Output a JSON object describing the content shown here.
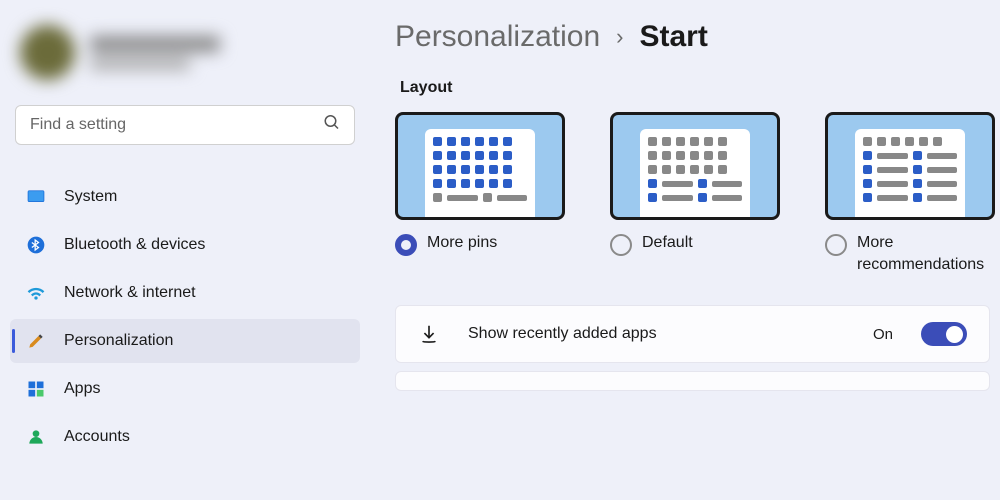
{
  "search": {
    "placeholder": "Find a setting"
  },
  "nav": {
    "system": "System",
    "bluetooth": "Bluetooth & devices",
    "network": "Network & internet",
    "personalization": "Personalization",
    "apps": "Apps",
    "accounts": "Accounts"
  },
  "breadcrumb": {
    "parent": "Personalization",
    "sep": "›",
    "current": "Start"
  },
  "section": {
    "layout": "Layout"
  },
  "layouts": {
    "more_pins": "More pins",
    "default": "Default",
    "more_recs": "More recommendations",
    "selected": "more_pins"
  },
  "settings": {
    "recently_added": {
      "label": "Show recently added apps",
      "state_text": "On",
      "on": true
    }
  }
}
